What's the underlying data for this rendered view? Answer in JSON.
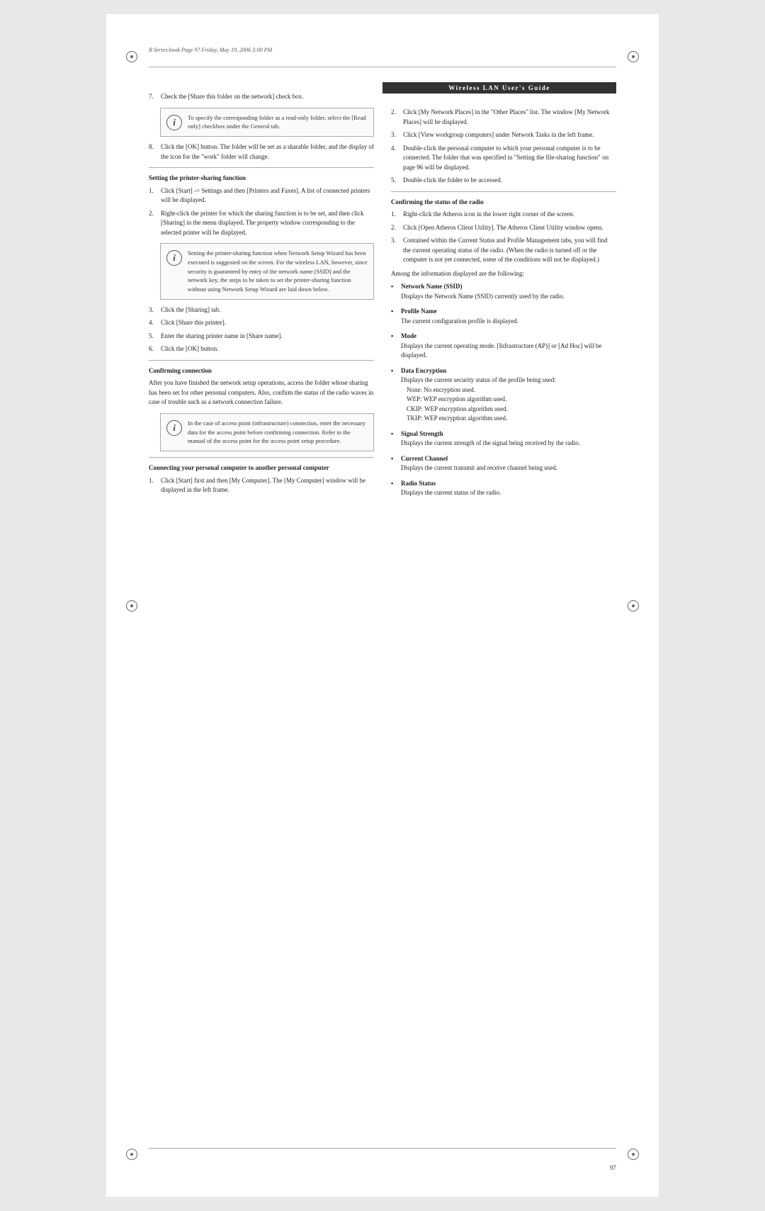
{
  "header": {
    "book_info": "B Series.book  Page 97  Friday, May 19, 2006  3:00 PM",
    "wlan_title": "Wireless LAN User's Guide",
    "page_number": "97"
  },
  "left_column": {
    "step7": {
      "num": "7.",
      "text": "Check the [Share this folder on the network] check box."
    },
    "info_box1": {
      "text": "To specify the corresponding folder as a read-only folder, select the [Read only] checkbox under the General tab."
    },
    "step8": {
      "num": "8.",
      "text": "Click the [OK] button. The folder will be set as a sharable folder, and the display of the icon for the \"work\" folder will change."
    },
    "section_printer": {
      "heading": "Setting the printer-sharing function",
      "steps": [
        {
          "num": "1.",
          "text": "Click [Start] -> Settings and then [Printers and Faxes]. A list of connected printers will be displayed."
        },
        {
          "num": "2.",
          "text": "Right-click the printer for which the sharing function is to be set, and then click [Sharing] in the menu displayed. The property window corresponding to the selected printer will be displayed."
        }
      ],
      "info_box": {
        "text": "Setting the printer-sharing function when Network Setup Wizard has been executed is suggested on the screen. For the wireless LAN, however, since security is guaranteed by entry of the network name (SSID) and the network key, the steps to be taken to set the printer-sharing function without using Network Setup Wizard are laid down below."
      },
      "steps2": [
        {
          "num": "3.",
          "text": "Click the [Sharing] tab."
        },
        {
          "num": "4.",
          "text": "Click [Share this printer]."
        },
        {
          "num": "5.",
          "text": "Enter the sharing printer name in [Share name]."
        },
        {
          "num": "6.",
          "text": "Click the [OK] button."
        }
      ]
    },
    "section_confirm_connection": {
      "heading": "Confirming connection",
      "intro": "After you have finished the network setup operations, access the folder whose sharing has been set for other personal computers. Also, confirm the status of the radio waves in case of trouble such as a network connection failure.",
      "info_box": {
        "text": "In the case of access point (infrastructure) connection, enter the necessary data for the access point before confirming connection. Refer to the manual of the access point for the access point setup procedure."
      }
    },
    "section_connect_pc": {
      "heading": "Connecting your personal computer to another personal computer",
      "steps": [
        {
          "num": "1.",
          "text": "Click [Start] first and then [My Computer]. The [My Computer] window will be displayed in the left frame."
        }
      ]
    }
  },
  "right_column": {
    "steps_cont": [
      {
        "num": "2.",
        "text": "Click [My Network Places] in the \"Other Places\" list. The window [My Network Places] will be displayed."
      },
      {
        "num": "3.",
        "text": "Click [View workgroup computers] under Network Tasks in the left frame."
      },
      {
        "num": "4.",
        "text": "Double-click the personal computer to which your personal computer is to be connected. The folder that was specified in \"Setting the file-sharing function\" on page 96 will be displayed."
      },
      {
        "num": "5.",
        "text": "Double-click the folder to be accessed."
      }
    ],
    "section_confirm_radio": {
      "heading": "Confirming the status of the radio",
      "steps": [
        {
          "num": "1.",
          "text": "Right-click the Atheros icon in the lower right corner of the screen."
        },
        {
          "num": "2.",
          "text": "Click [Open Atheros Client Utility]. The Atheros Client Utility window opens."
        },
        {
          "num": "3.",
          "text": "Contained within the Current Status and Profile Management tabs, you will find the current operating status of the radio. (When the radio is turned off or the computer is not yet connected, some of the conditions will not be displayed.)"
        }
      ],
      "among_info": "Among the information displayed are the following:",
      "bullet_items": [
        {
          "term": "Network Name (SSID)",
          "desc": "Displays the Network Name (SSID) currently used by the radio."
        },
        {
          "term": "Profile Name",
          "desc": "The current configuration profile is displayed."
        },
        {
          "term": "Mode",
          "desc": "Displays the current operating mode. [Infrastructure (AP)] or [Ad Hoc] will be displayed."
        },
        {
          "term": "Data Encryption",
          "desc": "Displays the current security status of the profile being used:",
          "sub_items": [
            "None: No encryption used.",
            "WEP: WEP encryption algorithm used.",
            "CKIP: WEP encryption algorithm used.",
            "TKIP: WEP encryption algorithm used."
          ]
        },
        {
          "term": "Signal Strength",
          "desc": "Displays the current strength of the signal being received by the radio."
        },
        {
          "term": "Current Channel",
          "desc": "Displays the current transmit and receive channel being used."
        },
        {
          "term": "Radio Status",
          "desc": "Displays the current status of the radio."
        }
      ]
    }
  }
}
